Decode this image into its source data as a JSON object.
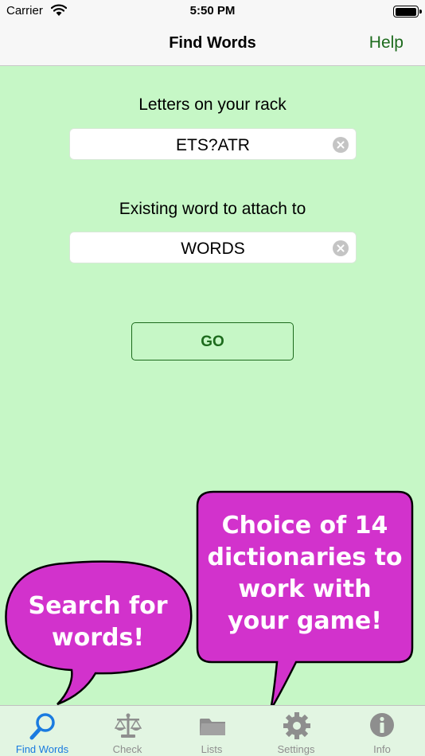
{
  "status_bar": {
    "carrier": "Carrier",
    "time": "5:50 PM",
    "battery_level": 1.0
  },
  "nav": {
    "title": "Find Words",
    "help": "Help"
  },
  "form": {
    "rack_label": "Letters on your rack",
    "rack_value": "ETS?ATR",
    "attach_label": "Existing word to attach to",
    "attach_value": "WORDS",
    "go_label": "GO"
  },
  "promo": {
    "bubble_left": [
      "Search for",
      "words!"
    ],
    "bubble_right": [
      "Choice of 14",
      "dictionaries to",
      "work with",
      "your game!"
    ]
  },
  "tabs": [
    {
      "label": "Find Words",
      "icon": "magnifier-icon",
      "active": true
    },
    {
      "label": "Check",
      "icon": "scales-icon",
      "active": false
    },
    {
      "label": "Lists",
      "icon": "folder-icon",
      "active": false
    },
    {
      "label": "Settings",
      "icon": "gear-icon",
      "active": false
    },
    {
      "label": "Info",
      "icon": "info-icon",
      "active": false
    }
  ],
  "colors": {
    "background": "#c6f7c6",
    "accent_green": "#1d6b1d",
    "bubble": "#d232cc",
    "tab_active": "#1a7be0",
    "tab_inactive": "#8e8e8e"
  }
}
